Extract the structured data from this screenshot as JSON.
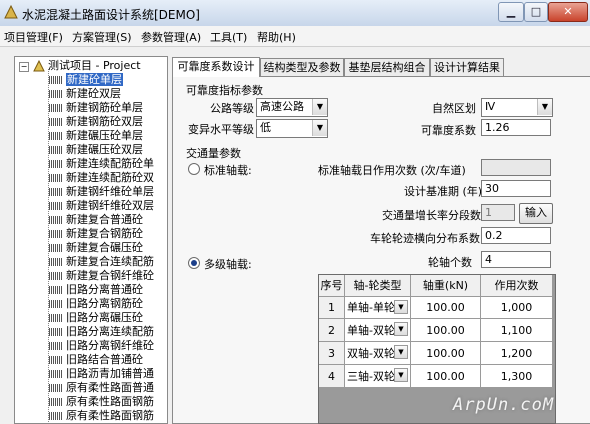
{
  "window": {
    "title": "水泥混凝土路面设计系统[DEMO]"
  },
  "menu": [
    "项目管理(F)",
    "方案管理(S)",
    "参数管理(A)",
    "工具(T)",
    "帮助(H)"
  ],
  "tree": {
    "root": "测试项目 - Project",
    "items": [
      "新建砼单层",
      "新建砼双层",
      "新建钢筋砼单层",
      "新建钢筋砼双层",
      "新建碾压砼单层",
      "新建碾压砼双层",
      "新建连续配筋砼单",
      "新建连续配筋砼双",
      "新建钢纤维砼单层",
      "新建钢纤维砼双层",
      "新建复合普通砼",
      "新建复合钢筋砼",
      "新建复合碾压砼",
      "新建复合连续配筋",
      "新建复合钢纤维砼",
      "旧路分离普通砼",
      "旧路分离钢筋砼",
      "旧路分离碾压砼",
      "旧路分离连续配筋",
      "旧路分离钢纤维砼",
      "旧路结合普通砼",
      "旧路沥青加铺普通",
      "原有柔性路面普通",
      "原有柔性路面钢筋",
      "原有柔性路面钢筋"
    ],
    "selected_index": 0
  },
  "tabs": [
    "可靠度系数设计",
    "结构类型及参数",
    "基垫层结构组合",
    "设计计算结果"
  ],
  "reliability": {
    "section": "可靠度指标参数",
    "road_grade_label": "公路等级",
    "road_grade_value": "高速公路",
    "variation_label": "变异水平等级",
    "variation_value": "低",
    "region_label": "自然区划",
    "region_value": "Ⅳ",
    "coef_label": "可靠度系数",
    "coef_value": "1.26"
  },
  "traffic": {
    "section": "交通量参数",
    "standard_label": "标准轴载:",
    "daily_label": "标准轴载日作用次数 (次/车道)",
    "daily_value": "",
    "period_label": "设计基准期 (年)",
    "period_value": "30",
    "growth_label": "交通量增长率分段数",
    "growth_value": "1",
    "input_button": "输入",
    "dist_label": "车轮轮迹横向分布系数",
    "dist_value": "0.2",
    "multi_label": "多级轴载:",
    "axle_count_label": "轮轴个数",
    "axle_count_value": "4"
  },
  "grid": {
    "headers": [
      "序号",
      "轴-轮类型",
      "轴重(kN)",
      "作用次数"
    ],
    "rows": [
      {
        "no": "1",
        "type": "单轴-单轮",
        "load": "100.00",
        "count": "1,000"
      },
      {
        "no": "2",
        "type": "单轴-双轮",
        "load": "100.00",
        "count": "1,100"
      },
      {
        "no": "3",
        "type": "双轴-双轮",
        "load": "100.00",
        "count": "1,200"
      },
      {
        "no": "4",
        "type": "三轴-双轮",
        "load": "100.00",
        "count": "1,300"
      }
    ]
  },
  "watermark": "ArpUn.coM"
}
